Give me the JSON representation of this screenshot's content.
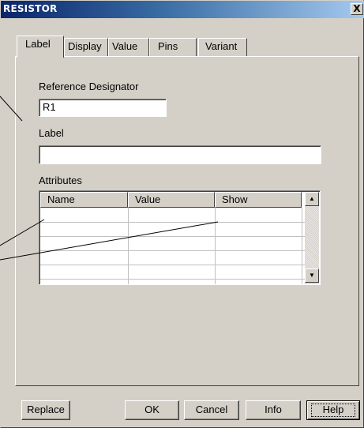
{
  "window": {
    "title": "RESISTOR",
    "close_glyph": "X"
  },
  "tabs": [
    {
      "label": "Label",
      "active": true
    },
    {
      "label": "Display",
      "active": false
    },
    {
      "label": "Value",
      "active": false
    },
    {
      "label": "Pins",
      "active": false
    },
    {
      "label": "Variant",
      "active": false
    }
  ],
  "form": {
    "refdes_label": "Reference Designator",
    "refdes_value": "R1",
    "label_label": "Label",
    "label_value": "",
    "attributes_label": "Attributes"
  },
  "attributes_table": {
    "columns": [
      "Name",
      "Value",
      "Show"
    ],
    "rows": [
      [
        "",
        "",
        ""
      ],
      [
        "",
        "",
        ""
      ],
      [
        "",
        "",
        ""
      ],
      [
        "",
        "",
        ""
      ],
      [
        "",
        "",
        ""
      ]
    ],
    "scroll_up_icon": "arrow-up-icon",
    "scroll_down_icon": "arrow-down-icon"
  },
  "buttons": {
    "replace": "Replace",
    "ok": "OK",
    "cancel": "Cancel",
    "info": "Info",
    "help": "Help"
  }
}
